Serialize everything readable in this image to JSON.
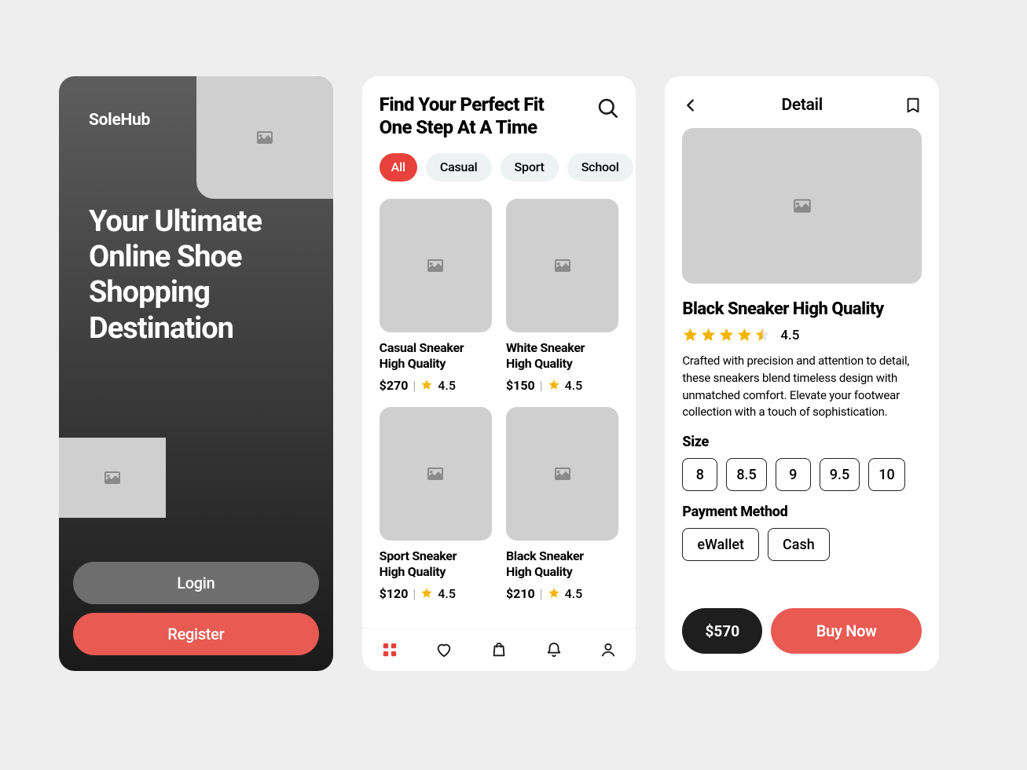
{
  "screen1": {
    "brand": "SoleHub",
    "headline": "Your Ultimate Online Shoe Shopping Destination",
    "login": "Login",
    "register": "Register"
  },
  "screen2": {
    "title_l1": "Find Your Perfect Fit",
    "title_l2": "One Step At A Time",
    "chips": {
      "all": "All",
      "casual": "Casual",
      "sport": "Sport",
      "school": "School"
    },
    "products": [
      {
        "name_l1": "Casual Sneaker",
        "name_l2": "High Quality",
        "price": "$270",
        "rating": "4.5"
      },
      {
        "name_l1": "White Sneaker",
        "name_l2": "High Quality",
        "price": "$150",
        "rating": "4.5"
      },
      {
        "name_l1": "Sport Sneaker",
        "name_l2": "High Quality",
        "price": "$120",
        "rating": "4.5"
      },
      {
        "name_l1": "Black Sneaker",
        "name_l2": "High Quality",
        "price": "$210",
        "rating": "4.5"
      }
    ]
  },
  "screen3": {
    "title": "Detail",
    "product_name": "Black Sneaker High Quality",
    "rating": "4.5",
    "description": "Crafted with precision and attention to detail, these sneakers blend timeless design with unmatched comfort. Elevate your footwear collection with a touch of sophistication.",
    "size_label": "Size",
    "sizes": [
      "8",
      "8.5",
      "9",
      "9.5",
      "10"
    ],
    "payment_label": "Payment Method",
    "payments": [
      "eWallet",
      "Cash"
    ],
    "price": "$570",
    "buy": "Buy Now"
  },
  "glyphs": {
    "pipe": "|"
  }
}
